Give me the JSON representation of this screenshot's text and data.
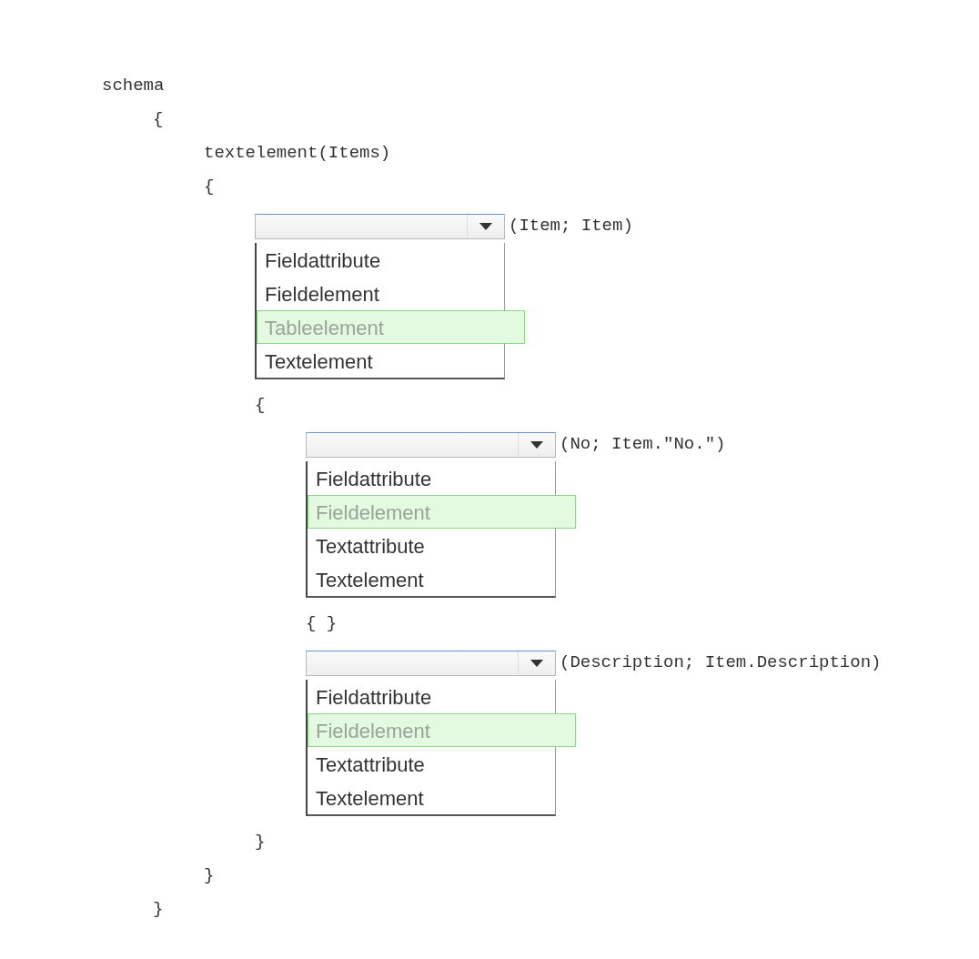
{
  "lines": [
    {
      "kind": "code",
      "text": "schema",
      "children": [
        {
          "kind": "code",
          "text": "{",
          "children": [
            {
              "kind": "code",
              "text": "textelement(Items)"
            },
            {
              "kind": "code",
              "text": "{",
              "children": [
                {
                  "kind": "dropdown",
                  "suffix": "(Item; Item)",
                  "options": [
                    {
                      "label": "Fieldattribute",
                      "selected": false
                    },
                    {
                      "label": "Fieldelement",
                      "selected": false
                    },
                    {
                      "label": "Tableelement",
                      "selected": true
                    },
                    {
                      "label": "Textelement",
                      "selected": false
                    }
                  ]
                },
                {
                  "kind": "code",
                  "text": "{",
                  "children": [
                    {
                      "kind": "dropdown",
                      "suffix": "(No; Item.\"No.\")",
                      "options": [
                        {
                          "label": "Fieldattribute",
                          "selected": false
                        },
                        {
                          "label": "Fieldelement",
                          "selected": true
                        },
                        {
                          "label": "Textattribute",
                          "selected": false
                        },
                        {
                          "label": "Textelement",
                          "selected": false
                        }
                      ]
                    },
                    {
                      "kind": "code",
                      "text": "{ }"
                    },
                    {
                      "kind": "dropdown",
                      "suffix": "(Description; Item.Description)",
                      "options": [
                        {
                          "label": "Fieldattribute",
                          "selected": false
                        },
                        {
                          "label": "Fieldelement",
                          "selected": true
                        },
                        {
                          "label": "Textattribute",
                          "selected": false
                        },
                        {
                          "label": "Textelement",
                          "selected": false
                        }
                      ]
                    }
                  ]
                },
                {
                  "kind": "code",
                  "text": "}"
                }
              ]
            },
            {
              "kind": "code",
              "text": "}"
            }
          ]
        },
        {
          "kind": "code",
          "text": "}"
        }
      ]
    }
  ]
}
